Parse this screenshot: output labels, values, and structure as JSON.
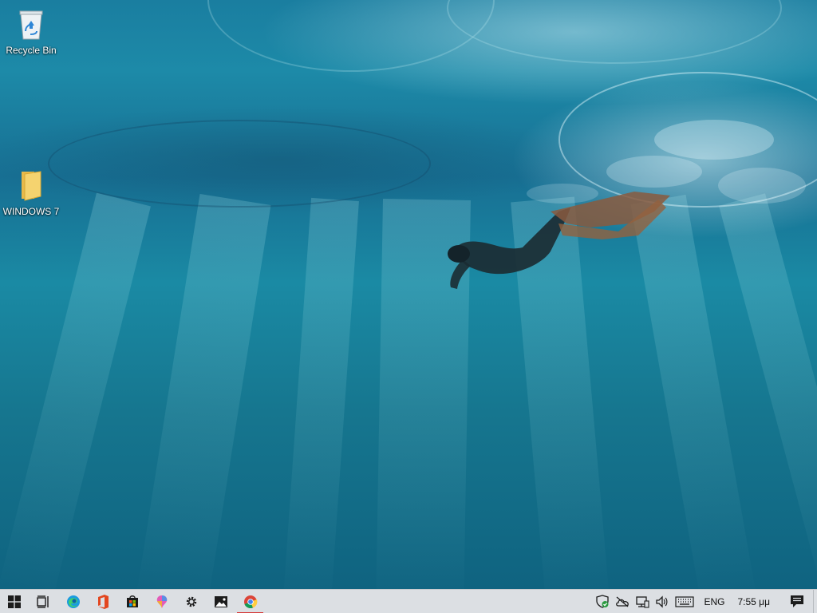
{
  "desktop": {
    "icons": [
      {
        "label": "Recycle Bin",
        "icon": "recycle-bin-icon"
      },
      {
        "label": "WINDOWS 7",
        "icon": "folder-icon"
      }
    ]
  },
  "taskbar": {
    "pinned": [
      {
        "name": "start",
        "icon": "windows-logo-icon"
      },
      {
        "name": "task-view",
        "icon": "task-view-icon"
      },
      {
        "name": "edge",
        "icon": "edge-icon"
      },
      {
        "name": "office",
        "icon": "office-icon"
      },
      {
        "name": "store",
        "icon": "store-icon"
      },
      {
        "name": "paint3d",
        "icon": "paint-icon"
      },
      {
        "name": "settings",
        "icon": "gear-icon"
      },
      {
        "name": "photos",
        "icon": "photos-icon"
      },
      {
        "name": "chrome",
        "icon": "chrome-icon",
        "active": true
      }
    ],
    "tray": {
      "icons": [
        "security-shield-icon",
        "onedrive-offline-icon",
        "network-icon",
        "volume-icon",
        "keyboard-icon"
      ],
      "language": "ENG",
      "time": "7:55 μμ"
    }
  },
  "colors": {
    "taskbar_bg": "#dcdfe3",
    "active_indicator": "#d53a3a",
    "water": "#1a7ea0"
  }
}
